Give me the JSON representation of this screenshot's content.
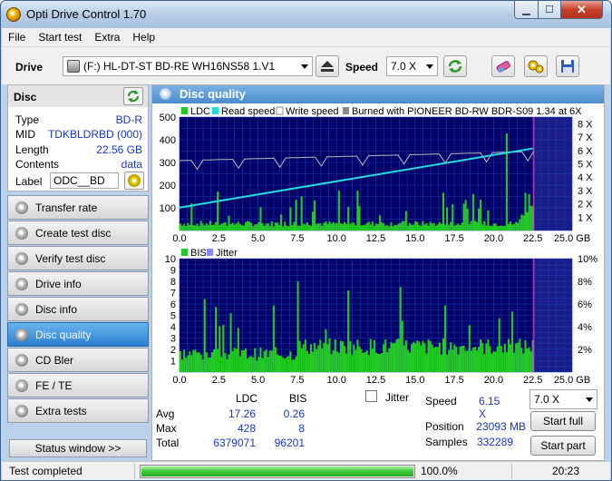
{
  "window": {
    "title": "Opti Drive Control 1.70"
  },
  "menu": [
    "File",
    "Start test",
    "Extra",
    "Help"
  ],
  "toolbar": {
    "drive_label": "Drive",
    "drive_value": "(F:)   HL-DT-ST BD-RE  WH16NS58 1.V1",
    "speed_label": "Speed",
    "speed_value": "7.0 X"
  },
  "disc": {
    "header": "Disc",
    "rows": [
      {
        "label": "Type",
        "value": "BD-R"
      },
      {
        "label": "MID",
        "value": "TDKBLDRBD (000)"
      },
      {
        "label": "Length",
        "value": "22.56 GB"
      },
      {
        "label": "Contents",
        "value": "data"
      }
    ],
    "label_caption": "Label",
    "label_value": "ODC__BD"
  },
  "nav": [
    {
      "label": "Transfer rate",
      "selected": false
    },
    {
      "label": "Create test disc",
      "selected": false
    },
    {
      "label": "Verify test disc",
      "selected": false
    },
    {
      "label": "Drive info",
      "selected": false
    },
    {
      "label": "Disc info",
      "selected": false
    },
    {
      "label": "Disc quality",
      "selected": true
    },
    {
      "label": "CD Bler",
      "selected": false
    },
    {
      "label": "FE / TE",
      "selected": false
    },
    {
      "label": "Extra tests",
      "selected": false
    }
  ],
  "status_window_btn": "Status window >>",
  "panel_title": "Disc quality",
  "chart_data": [
    {
      "type": "line",
      "legend": [
        "LDC",
        "Read speed",
        "Write speed",
        "Burned with PIONEER BD-RW   BDR-S09 1.34 at 6X"
      ],
      "colors": {
        "LDC": "#22cc22",
        "Read speed": "#22dddd",
        "Write speed": "#ffffff",
        "Burned": "#888888"
      },
      "x_ticks": [
        "0.0",
        "2.5",
        "5.0",
        "7.5",
        "10.0",
        "12.5",
        "15.0",
        "17.5",
        "20.0",
        "22.5",
        "25.0 GB"
      ],
      "y_ticks_left": [
        "500",
        "400",
        "300",
        "200",
        "100"
      ],
      "y_ticks_right": [
        "8 X",
        "7 X",
        "6 X",
        "5 X",
        "4 X",
        "3 X",
        "2 X",
        "1 X"
      ],
      "xlim": [
        0,
        25
      ],
      "ylim": [
        0,
        500
      ],
      "data_end": 22.56,
      "read_speed": {
        "x": [
          0,
          22.5
        ],
        "y_speed": [
          1.72,
          6.15
        ]
      }
    },
    {
      "type": "bar",
      "legend": [
        "BIS",
        "Jitter"
      ],
      "colors": {
        "BIS": "#22cc22",
        "Jitter": "#8888ff"
      },
      "x_ticks": [
        "0.0",
        "2.5",
        "5.0",
        "7.5",
        "10.0",
        "12.5",
        "15.0",
        "17.5",
        "20.0",
        "22.5",
        "25.0 GB"
      ],
      "y_ticks_left": [
        "10",
        "9",
        "8",
        "7",
        "6",
        "5",
        "4",
        "3",
        "2",
        "1"
      ],
      "y_ticks_right": [
        "10%",
        "8%",
        "6%",
        "4%",
        "2%"
      ],
      "xlim": [
        0,
        25
      ],
      "ylim": [
        0,
        10
      ],
      "data_end": 22.56
    }
  ],
  "stats": {
    "col_ldc": "LDC",
    "col_bis": "BIS",
    "rows": [
      {
        "label": "Avg",
        "ldc": "17.26",
        "bis": "0.26"
      },
      {
        "label": "Max",
        "ldc": "428",
        "bis": "8"
      },
      {
        "label": "Total",
        "ldc": "6379071",
        "bis": "96201"
      }
    ],
    "jitter_label": "Jitter",
    "speed_label": "Speed",
    "speed_value": "6.15 X",
    "position_label": "Position",
    "position_value": "23093 MB",
    "samples_label": "Samples",
    "samples_value": "332289",
    "speed_select": "7.0 X",
    "start_full": "Start full",
    "start_part": "Start part"
  },
  "statusbar": {
    "text": "Test completed",
    "progress": 100.0,
    "progress_text": "100.0%",
    "time": "20:23"
  }
}
